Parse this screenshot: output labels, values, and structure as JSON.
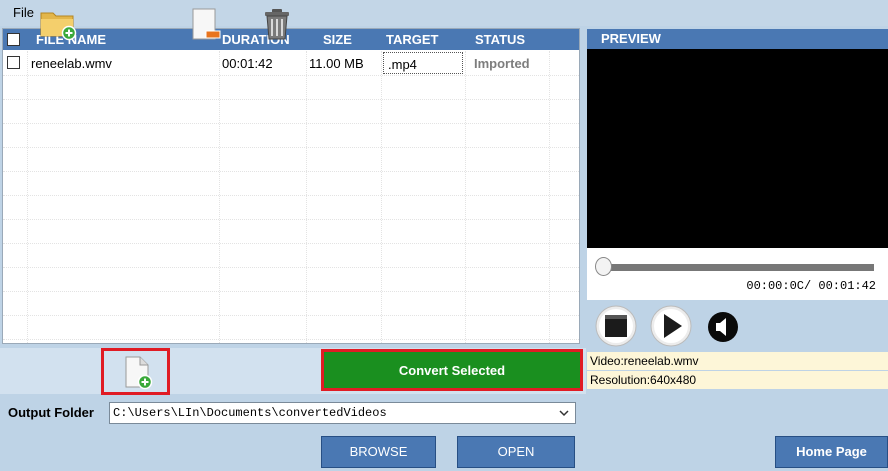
{
  "menu": {
    "file": "File"
  },
  "file_list": {
    "columns": {
      "name": "FILE NAME",
      "duration": "DURATION",
      "size": "SIZE",
      "target": "TARGET",
      "status": "STATUS"
    },
    "rows": [
      {
        "name": "reneelab.wmv",
        "duration": "00:01:42",
        "size": "11.00 MB",
        "target": ".mp4",
        "status": "Imported"
      }
    ]
  },
  "toolbar": {
    "add_folder_icon": "folder-add-icon",
    "add_file_icon": "file-add-icon",
    "remove_icon": "remove-item-icon",
    "delete_icon": "trash-icon",
    "convert_label": "Convert Selected"
  },
  "output": {
    "label": "Output Folder",
    "path": "C:\\Users\\LIn\\Documents\\convertedVideos",
    "browse_label": "BROWSE",
    "open_label": "OPEN"
  },
  "preview": {
    "title": "PREVIEW",
    "time": "00:00:0C/ 00:01:42",
    "seek_progress": 0,
    "video_info": "Video:reneelab.wmv",
    "resolution_info": "Resolution:640x480"
  },
  "home_page_label": "Home Page",
  "colors": {
    "header_blue": "#4a78b3",
    "background": "#bed3e6",
    "convert_green": "#1a8f1f",
    "highlight_red": "#e01b24",
    "status_grey": "#7d7d7d",
    "info_background": "#fdf6d8"
  }
}
